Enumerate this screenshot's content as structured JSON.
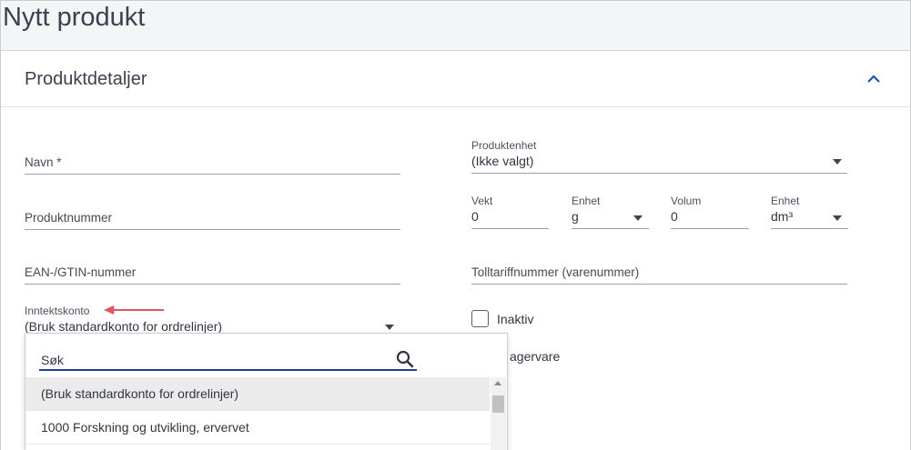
{
  "page": {
    "title": "Nytt produkt"
  },
  "section": {
    "title": "Produktdetaljer"
  },
  "fields": {
    "navn": {
      "placeholder": "Navn *"
    },
    "produktnummer": {
      "placeholder": "Produktnummer"
    },
    "ean": {
      "placeholder": "EAN-/GTIN-nummer"
    },
    "inntektskonto": {
      "label": "Inntektskonto",
      "value": "(Bruk standardkonto for ordrelinjer)"
    },
    "produktenhet": {
      "label": "Produktenhet",
      "value": "(Ikke valgt)"
    },
    "vekt": {
      "label": "Vekt",
      "value": "0"
    },
    "vekt_enhet": {
      "label": "Enhet",
      "value": "g"
    },
    "volum": {
      "label": "Volum",
      "value": "0"
    },
    "volum_enhet": {
      "label": "Enhet",
      "value": "dm³"
    },
    "tolltariff": {
      "placeholder": "Tolltariffnummer (varenummer)"
    }
  },
  "checkboxes": {
    "inaktiv": {
      "label": "Inaktiv"
    },
    "lagervare": {
      "label": "agervare"
    }
  },
  "dropdown": {
    "search_placeholder": "Søk",
    "options": [
      {
        "label": "(Bruk standardkonto for ordrelinjer)"
      },
      {
        "label": "1000 Forskning og utvikling, ervervet"
      }
    ]
  },
  "colors": {
    "accent": "#1f3f8f",
    "annotation_arrow": "#e05561"
  }
}
